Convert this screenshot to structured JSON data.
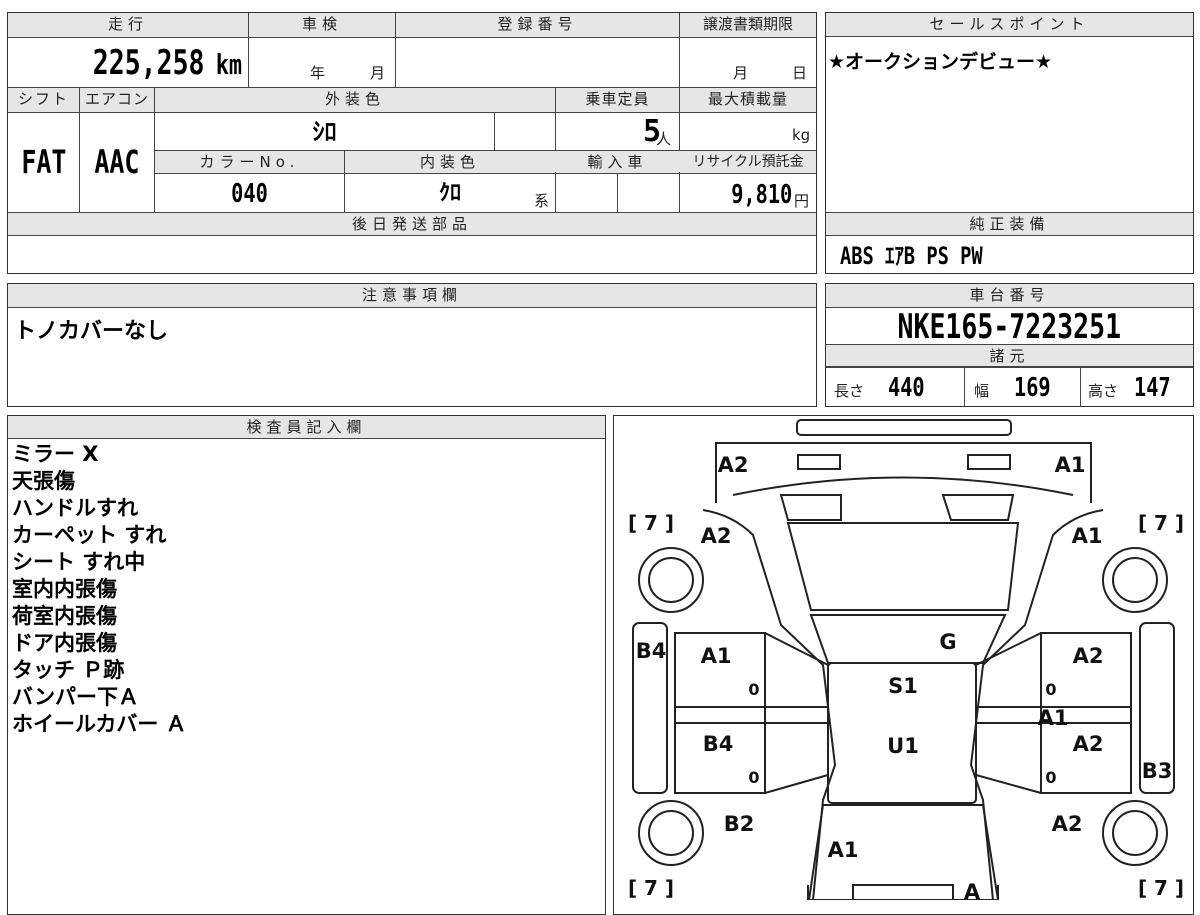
{
  "mileage": {
    "label": "走行",
    "value": "225,258",
    "unit": "km"
  },
  "inspection": {
    "label": "車検",
    "year_unit": "年",
    "month_unit": "月"
  },
  "registration": {
    "label": "登録番号",
    "value": ""
  },
  "transfer_deadline": {
    "label": "譲渡書類期限",
    "month_unit": "月",
    "day_unit": "日"
  },
  "sales_point": {
    "label": "セールスポイント",
    "text": "★オークションデビュー★"
  },
  "shift": {
    "label": "シフト",
    "value": "FAT"
  },
  "aircon": {
    "label": "エアコン",
    "value": "AAC"
  },
  "exterior_color": {
    "label": "外装色",
    "value": "ｼﾛ"
  },
  "capacity": {
    "label": "乗車定員",
    "value": "5",
    "unit": "人"
  },
  "max_load": {
    "label": "最大積載量",
    "value": "",
    "unit": "kg"
  },
  "color_no": {
    "label": "カラーNo.",
    "value": "040"
  },
  "interior_color": {
    "label": "内装色",
    "value": "ｸﾛ",
    "suffix": "系"
  },
  "import": {
    "label": "輸入車"
  },
  "recycle_fee": {
    "label": "リサイクル預託金",
    "value": "9,810",
    "unit": "円"
  },
  "later_parts": {
    "label": "後日発送部品",
    "value": ""
  },
  "genuine_equipment": {
    "label": "純正装備",
    "value": "ABS ｴｱB PS PW"
  },
  "notes": {
    "label": "注意事項欄",
    "text": "トノカバーなし"
  },
  "chassis_number": {
    "label": "車台番号",
    "value": "NKE165-7223251"
  },
  "specs": {
    "label": "諸元",
    "length_label": "長さ",
    "length": "440",
    "width_label": "幅",
    "width": "169",
    "height_label": "高さ",
    "height": "147"
  },
  "inspector": {
    "label": "検査員記入欄",
    "lines": [
      "ミラー X",
      "天張傷",
      "ハンドルすれ",
      "カーペット すれ",
      "シート すれ中",
      "室内内張傷",
      "荷室内張傷",
      "ドア内張傷",
      "タッチ Ｐ跡",
      "バンパー下Ａ",
      "ホイールカバー Ａ"
    ]
  },
  "diagram": {
    "codes": {
      "rear_left": "A2",
      "rear_right": "A1",
      "rear_quarter_left": "A2",
      "rear_quarter_right": "A1",
      "roof": "G",
      "rear_door_left": "A1",
      "rear_door_right": "A2",
      "sill_left": "B4",
      "sill_right": "B3",
      "roof_center": "S1",
      "hood_center": "U1",
      "mid_right": "A1",
      "front_door_left": "B4",
      "front_door_right": "A2",
      "front_fender_left": "B2",
      "front_fender_right": "A2",
      "hood": "A1",
      "front_bumper": "A"
    },
    "tire_marks": [
      "[ 7 ]",
      "[ 7 ]",
      "[ 7 ]",
      "[ 7 ]"
    ],
    "zeros": [
      "0",
      "0",
      "0",
      "0"
    ]
  }
}
